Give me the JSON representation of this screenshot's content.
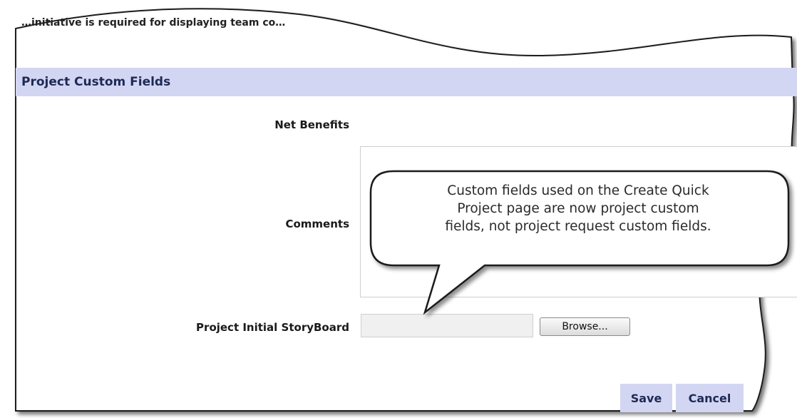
{
  "top_note": "…initiative is required for displaying team co…",
  "section": {
    "title": "Project Custom Fields"
  },
  "fields": {
    "net_benefits_label": "Net Benefits",
    "comments_label": "Comments",
    "comments_value": "",
    "storyboard_label": "Project Initial StoryBoard",
    "storyboard_value": "",
    "browse_label": "Browse..."
  },
  "actions": {
    "save_label": "Save",
    "cancel_label": "Cancel"
  },
  "callout": {
    "lines": [
      "Custom fields used on the Create Quick",
      "Project page are now project custom",
      "fields, not project request custom fields."
    ]
  },
  "colors": {
    "section_band": "#d3d6f2",
    "section_text": "#1d2a55",
    "callout_fill": "#ffffff",
    "callout_border": "#1a1a1a"
  }
}
